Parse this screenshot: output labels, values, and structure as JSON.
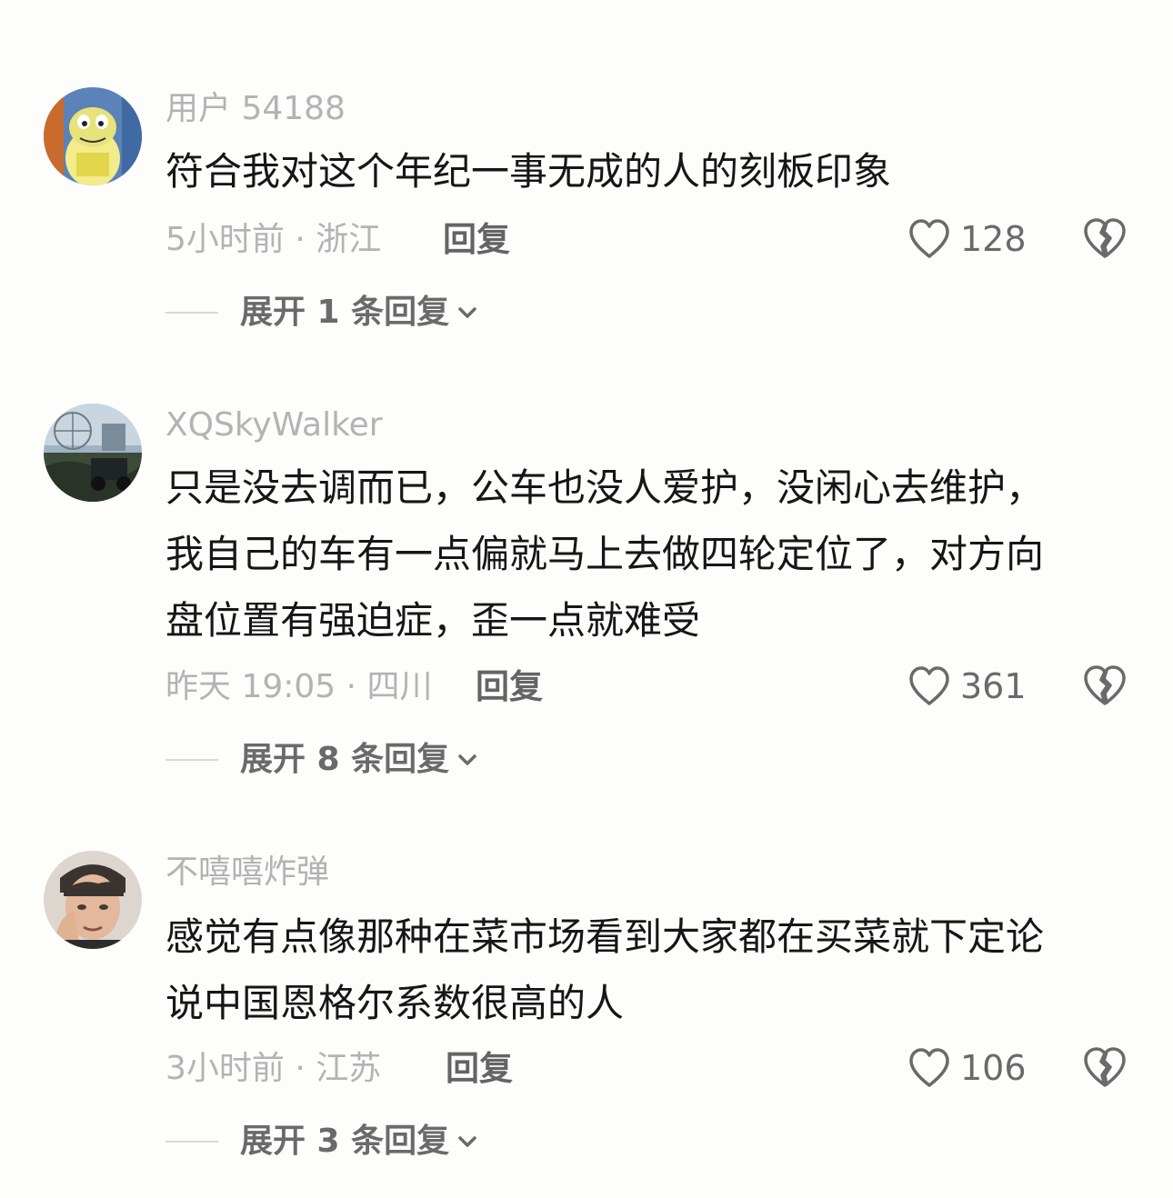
{
  "comments": [
    {
      "username": "用户 54188",
      "text_lines": [
        "符合我对这个年纪一事无成的人的刻板印象"
      ],
      "meta": "5小时前 · 浙江",
      "reply_label": "回复",
      "likes": "128",
      "expand_label": "展开 1 条回复"
    },
    {
      "username": "XQSkyWalker",
      "text_lines": [
        "只是没去调而已，公车也没人爱护，没闲心去维护，",
        "我自己的车有一点偏就马上去做四轮定位了，对方向",
        "盘位置有强迫症，歪一点就难受"
      ],
      "meta": "昨天 19:05 · 四川",
      "reply_label": "回复",
      "likes": "361",
      "expand_label": "展开 8 条回复"
    },
    {
      "username": "不嘻嘻炸弹",
      "text_lines": [
        "感觉有点像那种在菜市场看到大家都在买菜就下定论",
        "说中国恩格尔系数很高的人"
      ],
      "meta": "3小时前 · 江苏",
      "reply_label": "回复",
      "likes": "106",
      "expand_label": "展开 3 条回复"
    }
  ]
}
